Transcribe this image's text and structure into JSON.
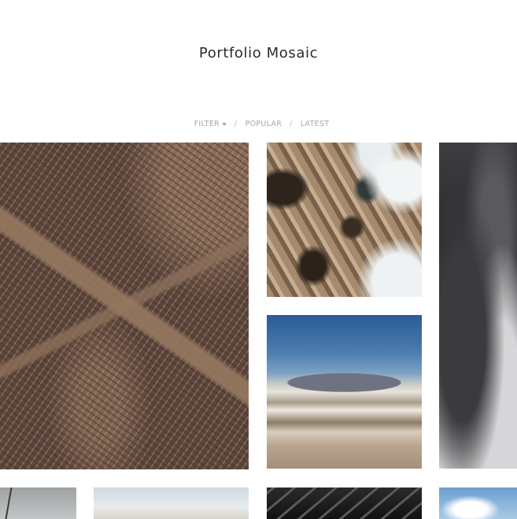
{
  "site": {
    "title": "Portfolio Mosaic"
  },
  "filters": {
    "filter_label": "FILTER",
    "separator": "/",
    "popular_label": "POPULAR",
    "latest_label": "LATEST"
  },
  "gallery": {
    "tiles": [
      {
        "name": "aerial-city-image"
      },
      {
        "name": "icy-terrain-image"
      },
      {
        "name": "clouds-mountain-image"
      },
      {
        "name": "storm-cloud-image"
      },
      {
        "name": "street-pole-image"
      },
      {
        "name": "pale-sky-image"
      },
      {
        "name": "steel-structure-image"
      },
      {
        "name": "blue-sky-cloud-image"
      }
    ]
  }
}
